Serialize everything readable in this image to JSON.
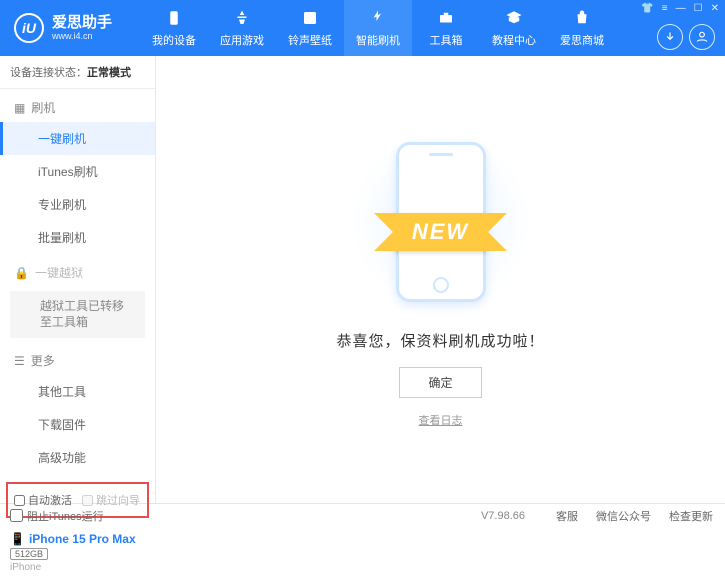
{
  "brand": {
    "title": "爱思助手",
    "subtitle": "www.i4.cn",
    "logo_letter": "iU"
  },
  "nav": [
    {
      "label": "我的设备"
    },
    {
      "label": "应用游戏"
    },
    {
      "label": "铃声壁纸"
    },
    {
      "label": "智能刷机"
    },
    {
      "label": "工具箱"
    },
    {
      "label": "教程中心"
    },
    {
      "label": "爱思商城"
    }
  ],
  "status": {
    "label": "设备连接状态：",
    "value": "正常模式"
  },
  "sidebar": {
    "flash_group": "刷机",
    "items1": [
      "一键刷机",
      "iTunes刷机",
      "专业刷机",
      "批量刷机"
    ],
    "jailbreak_group": "一键越狱",
    "jailbreak_note": "越狱工具已转移至工具箱",
    "more_group": "更多",
    "items2": [
      "其他工具",
      "下载固件",
      "高级功能"
    ],
    "checks": {
      "auto_activate": "自动激活",
      "skip_guide": "跳过向导"
    },
    "device": {
      "name": "iPhone 15 Pro Max",
      "storage": "512GB",
      "type": "iPhone"
    }
  },
  "main": {
    "ribbon": "NEW",
    "success": "恭喜您，保资料刷机成功啦！",
    "ok": "确定",
    "log": "查看日志"
  },
  "footer": {
    "block_itunes": "阻止iTunes运行",
    "version": "V7.98.66",
    "links": [
      "客服",
      "微信公众号",
      "检查更新"
    ]
  }
}
